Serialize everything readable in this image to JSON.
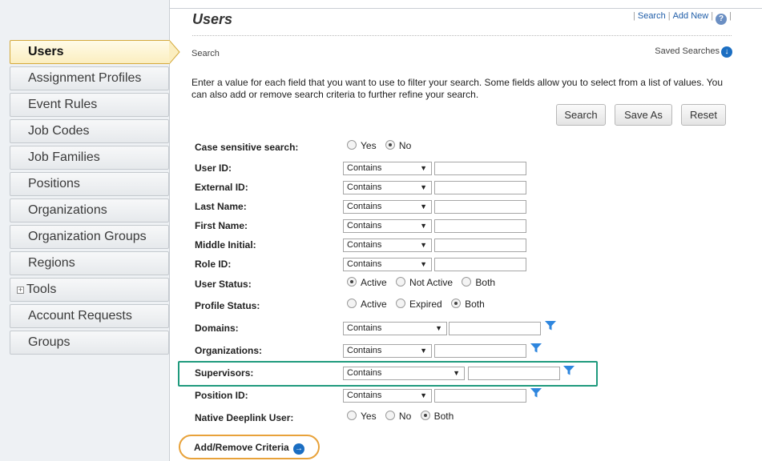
{
  "sidebar": {
    "items": [
      {
        "label": "Users",
        "active": true
      },
      {
        "label": "Assignment Profiles"
      },
      {
        "label": "Event Rules"
      },
      {
        "label": "Job Codes"
      },
      {
        "label": "Job Families"
      },
      {
        "label": "Positions"
      },
      {
        "label": "Organizations"
      },
      {
        "label": "Organization Groups"
      },
      {
        "label": "Regions"
      },
      {
        "label": "Tools"
      },
      {
        "label": "Account Requests"
      },
      {
        "label": "Groups"
      }
    ]
  },
  "header": {
    "title": "Users",
    "links": {
      "search": "Search",
      "add_new": "Add New"
    },
    "help_icon": "help-icon",
    "help_glyph": "?"
  },
  "section": {
    "label": "Search",
    "saved_searches": "Saved Searches",
    "saved_icon": "down-arrow-circle-icon"
  },
  "instructions": "Enter a value for each field that you want to use to filter your search. Some fields allow you to select from a list of values. You can also add or remove search criteria to further refine your search.",
  "buttons": {
    "search": "Search",
    "save_as": "Save As",
    "reset": "Reset"
  },
  "form": {
    "case_sensitive": {
      "label": "Case sensitive search:",
      "options": [
        "Yes",
        "No"
      ],
      "selected": "No"
    },
    "user_id": {
      "label": "User ID:",
      "operator": "Contains",
      "value": ""
    },
    "external_id": {
      "label": "External ID:",
      "operator": "Contains",
      "value": ""
    },
    "last_name": {
      "label": "Last Name:",
      "operator": "Contains",
      "value": ""
    },
    "first_name": {
      "label": "First Name:",
      "operator": "Contains",
      "value": ""
    },
    "middle_initial": {
      "label": "Middle Initial:",
      "operator": "Contains",
      "value": ""
    },
    "role_id": {
      "label": "Role ID:",
      "operator": "Contains",
      "value": ""
    },
    "user_status": {
      "label": "User Status:",
      "options": [
        "Active",
        "Not Active",
        "Both"
      ],
      "selected": "Active"
    },
    "profile_status": {
      "label": "Profile Status:",
      "options": [
        "Active",
        "Expired",
        "Both"
      ],
      "selected": "Both"
    },
    "domains": {
      "label": "Domains:",
      "operator": "Contains",
      "value": ""
    },
    "organizations": {
      "label": "Organizations:",
      "operator": "Contains",
      "value": ""
    },
    "supervisors": {
      "label": "Supervisors:",
      "operator": "Contains",
      "value": ""
    },
    "position_id": {
      "label": "Position ID:",
      "operator": "Contains",
      "value": ""
    },
    "native_deeplink": {
      "label": "Native Deeplink User:",
      "options": [
        "Yes",
        "No",
        "Both"
      ],
      "selected": "Both"
    }
  },
  "add_remove": {
    "label": "Add/Remove Criteria",
    "icon": "right-arrow-circle-icon"
  },
  "colors": {
    "link": "#1f5da8",
    "filter_icon": "#2e86de",
    "highlight_green": "#1f9a7d",
    "highlight_orange": "#e8a23a",
    "active_nav": "#fbeec0"
  },
  "glyphs": {
    "dropdown": "▼",
    "tools_expand": "+",
    "arrow_down": "↓",
    "arrow_right": "→"
  }
}
